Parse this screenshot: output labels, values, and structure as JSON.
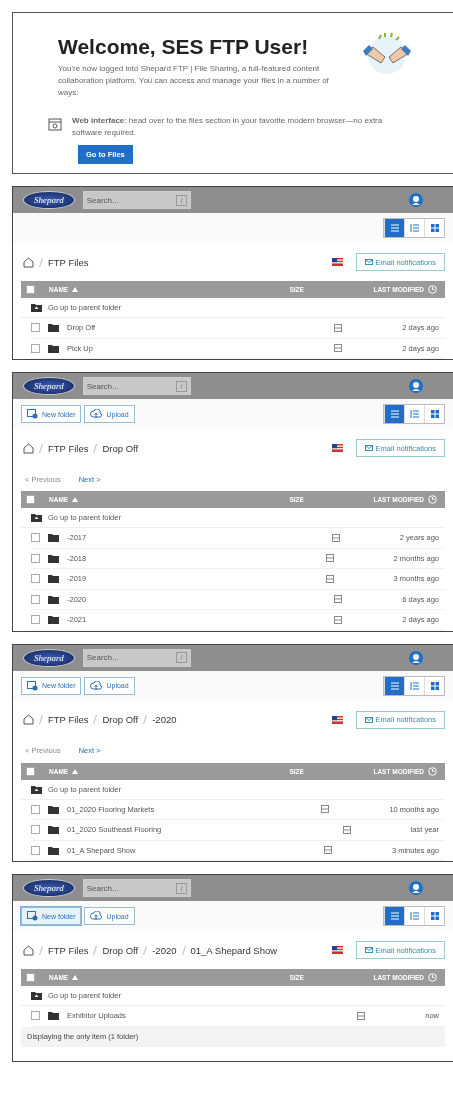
{
  "welcome": {
    "title": "Welcome, SES FTP User!",
    "intro": "You're now logged into Shepard FTP | File Sharing, a full-featured content collaboration platform. You can access and manage your files in a number of ways:",
    "option": "**Web interface**: head over to the files section in your favorite modern browser—no extra software required.",
    "button": "Go to Files"
  },
  "screens": [
    {
      "logo": "Shepard",
      "search": {
        "placeholder": "Search..."
      },
      "views": [
        {
          "selected": true
        },
        {
          "selected": false
        },
        {
          "selected": false
        }
      ],
      "breadcrumb": [
        "FTP Files"
      ],
      "email_button": "Email notifications",
      "columns": [
        "NAME",
        "SIZE",
        "LAST MODIFIED"
      ],
      "parent_link": "Go up to parent folder",
      "select_all_checked": false,
      "rows": [
        {
          "name": "Drop Off",
          "modified": "2 days ago",
          "checked": false
        },
        {
          "name": "Pick Up",
          "modified": "2 days ago",
          "checked": false
        }
      ]
    },
    {
      "logo": "Shepard",
      "search": {
        "placeholder": "Search..."
      },
      "toolbar": [
        {
          "kind": "new-folder",
          "label": "New folder",
          "focused": false
        },
        {
          "kind": "upload",
          "label": "Upload",
          "focused": false
        }
      ],
      "views": [
        {
          "selected": true
        },
        {
          "selected": false
        },
        {
          "selected": false
        }
      ],
      "breadcrumb": [
        "FTP Files",
        "Drop Off"
      ],
      "email_button": "Email notifications",
      "pager": {
        "previous": "< Previous",
        "previous_disabled": true,
        "next": "Next >"
      },
      "columns": [
        "NAME",
        "SIZE",
        "LAST MODIFIED"
      ],
      "parent_link": "Go up to parent folder",
      "select_all_checked": false,
      "rows": [
        {
          "name": "-2017",
          "modified": "2 years ago",
          "checked": false
        },
        {
          "name": "-2018",
          "modified": "2 months ago",
          "checked": false
        },
        {
          "name": "-2019",
          "modified": "3 months ago",
          "checked": false
        },
        {
          "name": "-2020",
          "modified": "6 days ago",
          "checked": false
        },
        {
          "name": "-2021",
          "modified": "2 days ago",
          "checked": false
        }
      ]
    },
    {
      "logo": "Shepard",
      "search": {
        "placeholder": "Search..."
      },
      "toolbar": [
        {
          "kind": "new-folder",
          "label": "New folder",
          "focused": false
        },
        {
          "kind": "upload",
          "label": "Upload",
          "focused": false
        }
      ],
      "views": [
        {
          "selected": true
        },
        {
          "selected": false
        },
        {
          "selected": false
        }
      ],
      "breadcrumb": [
        "FTP Files",
        "Drop Off",
        "-2020"
      ],
      "email_button": "Email notifications",
      "pager": {
        "previous": "< Previous",
        "previous_disabled": true,
        "next": "Next >"
      },
      "columns": [
        "NAME",
        "SIZE",
        "LAST MODIFIED"
      ],
      "parent_link": "Go up to parent folder",
      "select_all_checked": false,
      "rows": [
        {
          "name": "01_2020 Flooring Markets",
          "modified": "10 months ago",
          "checked": false
        },
        {
          "name": "01_2020 Southeast Flooring",
          "modified": "last year",
          "checked": false
        },
        {
          "name": "01_A Shepard Show",
          "modified": "3 minutes ago",
          "checked": false
        }
      ]
    },
    {
      "logo": "Shepard",
      "search": {
        "placeholder": "Search..."
      },
      "toolbar": [
        {
          "kind": "new-folder",
          "label": "New folder",
          "focused": true
        },
        {
          "kind": "upload",
          "label": "Upload",
          "focused": false
        }
      ],
      "views": [
        {
          "selected": true
        },
        {
          "selected": false
        },
        {
          "selected": false
        }
      ],
      "breadcrumb": [
        "FTP Files",
        "Drop Off",
        "-2020",
        "01_A Shepard Show"
      ],
      "email_button": "Email notifications",
      "columns": [
        "NAME",
        "SIZE",
        "LAST MODIFIED"
      ],
      "parent_link": "Go up to parent folder",
      "select_all_checked": false,
      "rows": [
        {
          "name": "Exhibitor Uploads",
          "modified": "now",
          "checked": false
        }
      ],
      "footer": "Displaying the only item (1 folder)"
    }
  ]
}
